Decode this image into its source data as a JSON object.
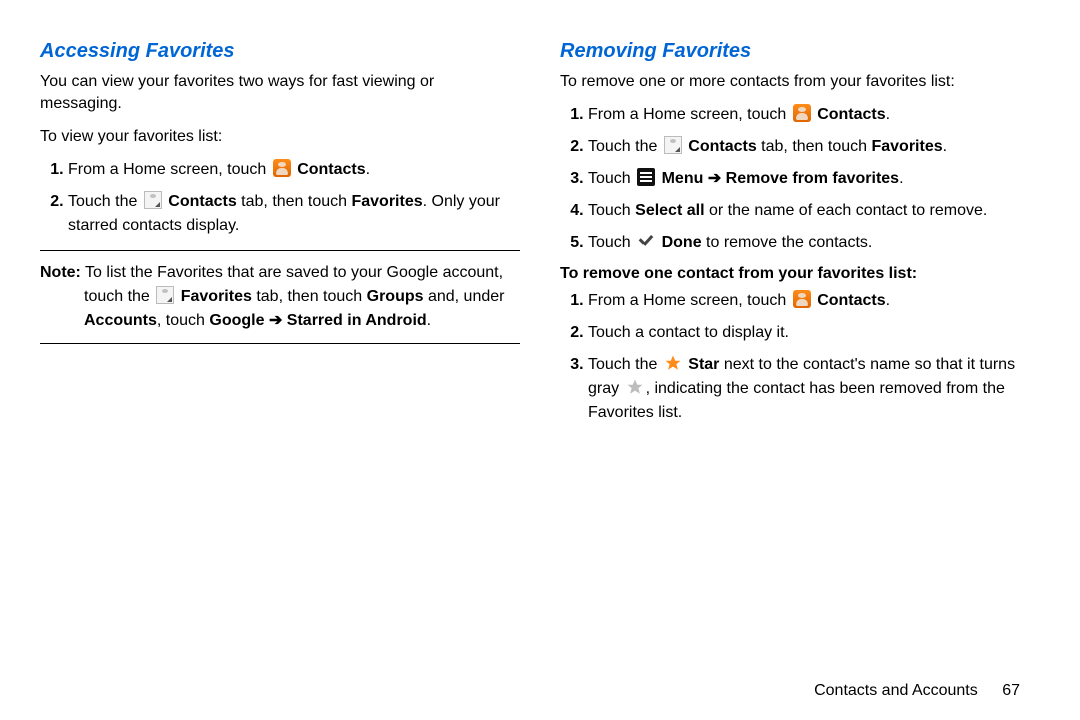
{
  "left": {
    "heading": "Accessing Favorites",
    "intro": "You can view your favorites two ways for fast viewing or messaging.",
    "lead": "To view your favorites list:",
    "steps": {
      "s1_a": "From a Home screen, touch ",
      "s1_b": "Contacts",
      "s1_c": ".",
      "s2_a": "Touch the ",
      "s2_b": "Contacts",
      "s2_c": " tab, then touch ",
      "s2_d": "Favorites",
      "s2_e": ". Only your starred contacts display."
    },
    "note": {
      "label": "Note:",
      "a": " To list the Favorites that are saved to your Google account, touch the ",
      "b": "Favorites",
      "c": " tab, then touch ",
      "d": "Groups",
      "e": " and, under ",
      "f": "Accounts",
      "g": ", touch ",
      "h": "Google",
      "arrow": " ➔ ",
      "i": "Starred in Android",
      "j": "."
    }
  },
  "right": {
    "heading": "Removing Favorites",
    "intro": "To remove one or more contacts from your favorites list:",
    "stepsA": {
      "s1_a": "From a Home screen, touch ",
      "s1_b": "Contacts",
      "s1_c": ".",
      "s2_a": "Touch the ",
      "s2_b": "Contacts",
      "s2_c": " tab, then touch ",
      "s2_d": "Favorites",
      "s2_e": ".",
      "s3_a": "Touch ",
      "s3_b": "Menu",
      "s3_arrow": " ➔ ",
      "s3_c": "Remove from favorites",
      "s3_d": ".",
      "s4_a": "Touch ",
      "s4_b": "Select all",
      "s4_c": " or the name of each contact to remove.",
      "s5_a": "Touch ",
      "s5_b": "Done",
      "s5_c": " to remove the contacts."
    },
    "subhead": "To remove one contact from your favorites list:",
    "stepsB": {
      "s1_a": "From a Home screen, touch ",
      "s1_b": "Contacts",
      "s1_c": ".",
      "s2": "Touch a contact to display it.",
      "s3_a": "Touch the ",
      "s3_b": "Star",
      "s3_c": " next to the contact's name so that it turns gray ",
      "s3_d": ", indicating the contact has been removed from the Favorites list."
    }
  },
  "footer": {
    "section": "Contacts and Accounts",
    "page": "67"
  }
}
